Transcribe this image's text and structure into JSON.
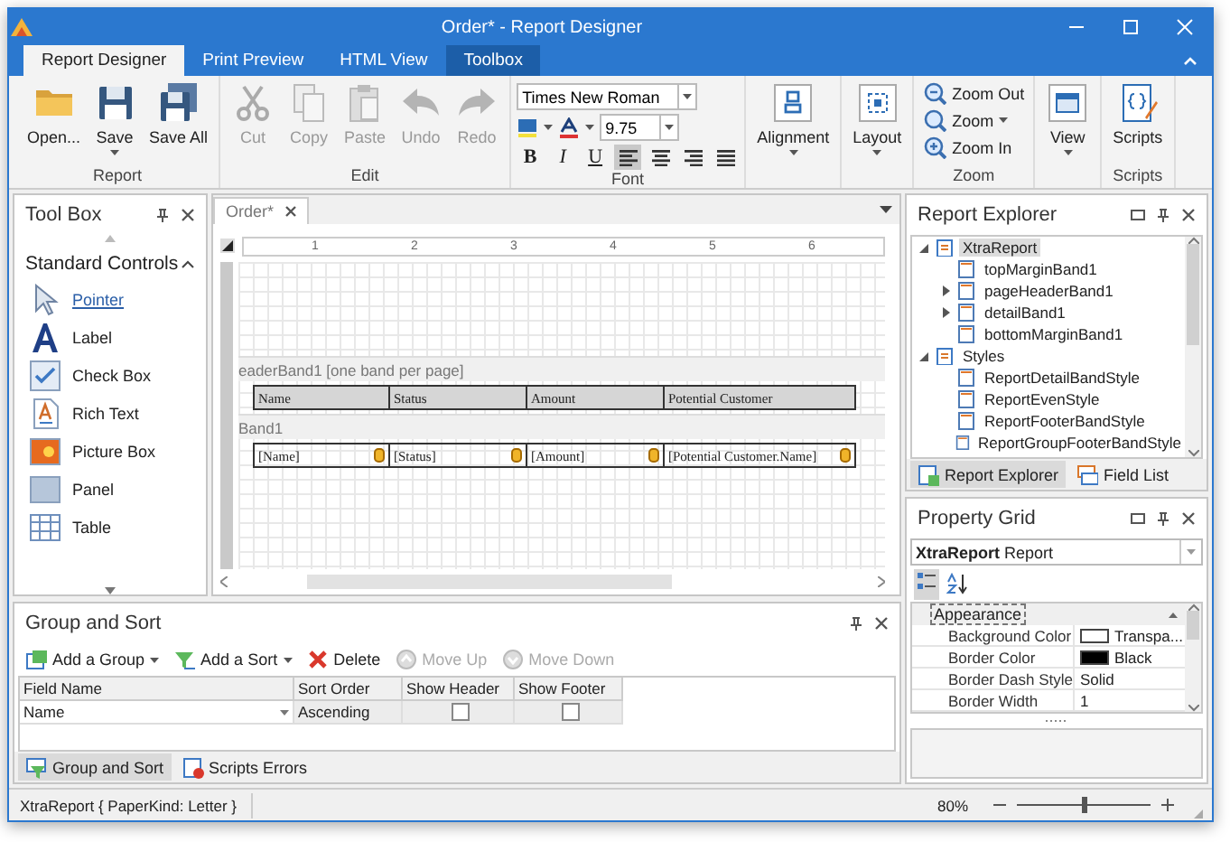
{
  "window": {
    "title": "Order* - Report Designer"
  },
  "ribbon": {
    "tabs": [
      {
        "label": "Report Designer",
        "selected": true,
        "kind": "page"
      },
      {
        "label": "Print Preview",
        "selected": false,
        "kind": "page"
      },
      {
        "label": "HTML View",
        "selected": false,
        "kind": "page"
      },
      {
        "label": "Toolbox",
        "selected": false,
        "kind": "context"
      }
    ],
    "groups": [
      {
        "kind": "large",
        "label": "Report",
        "buttons": [
          {
            "label": "Open...",
            "disabled": false,
            "dropdown": false
          },
          {
            "label": "Save",
            "disabled": false,
            "dropdown": true
          },
          {
            "label": "Save All",
            "disabled": false,
            "dropdown": false
          }
        ]
      },
      {
        "kind": "large",
        "label": "Edit",
        "buttons": [
          {
            "label": "Cut",
            "disabled": true,
            "dropdown": false
          },
          {
            "label": "Copy",
            "disabled": true,
            "dropdown": false
          },
          {
            "label": "Paste",
            "disabled": true,
            "dropdown": false
          },
          {
            "label": "Undo",
            "disabled": true,
            "dropdown": false
          },
          {
            "label": "Redo",
            "disabled": true,
            "dropdown": false
          }
        ]
      },
      {
        "kind": "font",
        "label": "Font",
        "font_name": "Times New Roman",
        "font_size": "9.75",
        "styles": [
          "B",
          "I",
          "U"
        ],
        "alignments": [
          {
            "selected": true
          },
          {
            "selected": false
          },
          {
            "selected": false
          },
          {
            "selected": false
          }
        ]
      },
      {
        "kind": "large",
        "buttons": [
          {
            "label": "Alignment",
            "disabled": false,
            "dropdown": true
          }
        ]
      },
      {
        "kind": "large",
        "buttons": [
          {
            "label": "Layout",
            "disabled": false,
            "dropdown": true
          }
        ]
      },
      {
        "kind": "small",
        "label": "Zoom",
        "buttons": [
          {
            "label": "Zoom Out",
            "disabled": false,
            "dropdown": false
          },
          {
            "label": "Zoom",
            "disabled": false,
            "dropdown": true
          },
          {
            "label": "Zoom In",
            "disabled": false,
            "dropdown": false
          }
        ]
      },
      {
        "kind": "large",
        "buttons": [
          {
            "label": "View",
            "disabled": false,
            "dropdown": true
          }
        ]
      },
      {
        "kind": "large",
        "label": "Scripts",
        "buttons": [
          {
            "label": "Scripts",
            "disabled": false,
            "dropdown": false
          }
        ]
      }
    ]
  },
  "toolbox": {
    "title": "Tool Box",
    "section": {
      "label": "Standard Controls",
      "expanded": true
    },
    "items": [
      {
        "label": "Pointer",
        "selected": true
      },
      {
        "label": "Label",
        "selected": false
      },
      {
        "label": "Check Box",
        "selected": false
      },
      {
        "label": "Rich Text",
        "selected": false
      },
      {
        "label": "Picture Box",
        "selected": false
      },
      {
        "label": "Panel",
        "selected": false
      },
      {
        "label": "Table",
        "selected": false
      }
    ]
  },
  "document": {
    "tab": "Order*",
    "ruler": [
      "1",
      "2",
      "3",
      "4",
      "5",
      "6"
    ],
    "bands": [
      {
        "kind": "header",
        "label": "eaderBand1 [one band per page]",
        "cells": [
          "Name",
          "Status",
          "Amount",
          "Potential Customer"
        ]
      },
      {
        "kind": "detail",
        "label": "Band1",
        "cells": [
          "[Name]",
          "[Status]",
          "[Amount]",
          "[Potential Customer.Name]"
        ]
      }
    ]
  },
  "report_explorer": {
    "title": "Report Explorer",
    "tree": [
      {
        "label": "XtraReport",
        "expanded": true,
        "selected": true,
        "children": [
          {
            "label": "topMarginBand1",
            "selected": false
          },
          {
            "label": "pageHeaderBand1",
            "expanded": false,
            "selected": false
          },
          {
            "label": "detailBand1",
            "expanded": false,
            "selected": false
          },
          {
            "label": "bottomMarginBand1",
            "selected": false
          }
        ]
      },
      {
        "label": "Styles",
        "expanded": true,
        "selected": false,
        "children": [
          {
            "label": "ReportDetailBandStyle",
            "selected": false
          },
          {
            "label": "ReportEvenStyle",
            "selected": false
          },
          {
            "label": "ReportFooterBandStyle",
            "selected": false
          },
          {
            "label": "ReportGroupFooterBandStyle",
            "selected": false
          }
        ]
      }
    ],
    "tabs": [
      {
        "label": "Report Explorer",
        "selected": true
      },
      {
        "label": "Field List",
        "selected": false
      }
    ]
  },
  "property_grid": {
    "title": "Property Grid",
    "object": "**XtraReport**  Report",
    "category": {
      "label": "Appearance",
      "expanded": true
    },
    "rows": [
      {
        "name": "Background Color",
        "value": "Transpa...",
        "color": "#ffffff"
      },
      {
        "name": "Border Color",
        "value": "Black",
        "color": "#000000"
      },
      {
        "name": "Border Dash Style",
        "value": "Solid"
      },
      {
        "name": "Border Width",
        "value": "1"
      }
    ]
  },
  "group_sort": {
    "title": "Group and Sort",
    "toolbar": [
      {
        "label": "Add a Group",
        "dropdown": true,
        "disabled": false
      },
      {
        "label": "Add a Sort",
        "dropdown": true,
        "disabled": false
      },
      {
        "label": "Delete",
        "dropdown": false,
        "disabled": false
      },
      {
        "label": "Move Up",
        "dropdown": false,
        "disabled": true
      },
      {
        "label": "Move Down",
        "dropdown": false,
        "disabled": true
      }
    ],
    "columns": [
      "Field Name",
      "Sort Order",
      "Show Header",
      "Show Footer"
    ],
    "rows": [
      {
        "field_name": "Name",
        "sort_order": "Ascending",
        "show_header": false,
        "show_footer": false
      }
    ],
    "tabs": [
      {
        "label": "Group and Sort",
        "selected": true
      },
      {
        "label": "Scripts Errors",
        "selected": false
      }
    ]
  },
  "status_bar": {
    "text": "XtraReport { PaperKind: Letter }",
    "zoom": "80%",
    "zoom_slider": {
      "level": 0.5
    }
  }
}
